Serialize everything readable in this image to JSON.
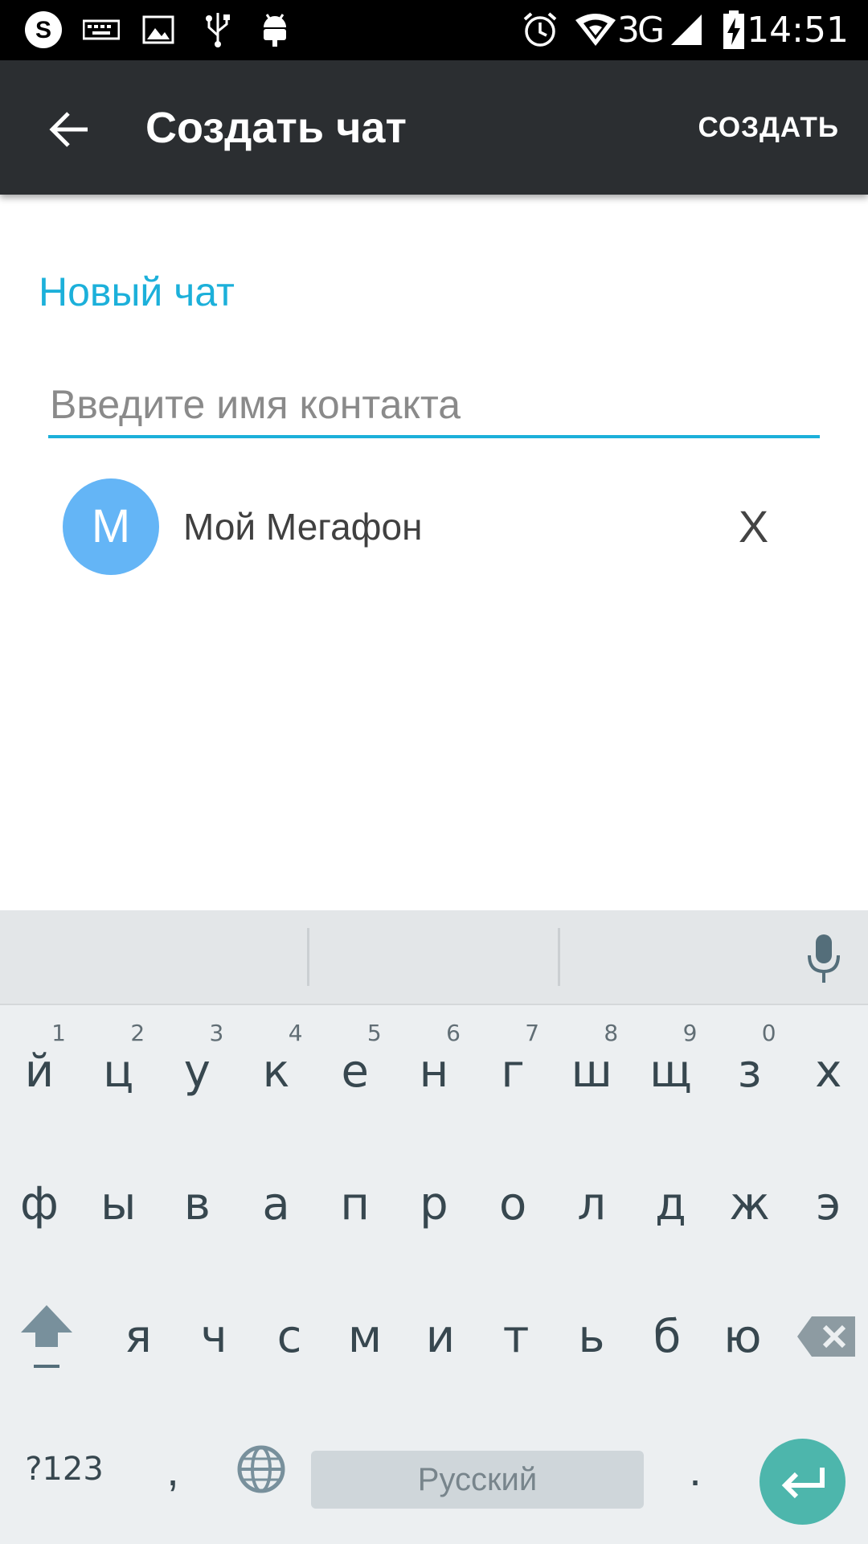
{
  "status_bar": {
    "time": "14:51",
    "network": "3G",
    "icons": [
      "skype-icon",
      "keyboard-icon",
      "image-icon",
      "usb-icon",
      "android-debug-icon",
      "alarm-icon",
      "wifi-icon",
      "signal-icon",
      "battery-charging-icon"
    ]
  },
  "toolbar": {
    "title": "Создать чат",
    "action_label": "СОЗДАТЬ",
    "back_icon": "arrow-back-icon"
  },
  "content": {
    "section_title": "Новый чат",
    "contact_input": {
      "value": "",
      "placeholder": "Введите имя контакта"
    },
    "selected_contacts": [
      {
        "initial": "M",
        "name": "Мой Мегафон",
        "remove_label": "X"
      }
    ]
  },
  "keyboard": {
    "row1": [
      {
        "letter": "й",
        "hint": "1"
      },
      {
        "letter": "ц",
        "hint": "2"
      },
      {
        "letter": "у",
        "hint": "3"
      },
      {
        "letter": "к",
        "hint": "4"
      },
      {
        "letter": "е",
        "hint": "5"
      },
      {
        "letter": "н",
        "hint": "6"
      },
      {
        "letter": "г",
        "hint": "7"
      },
      {
        "letter": "ш",
        "hint": "8"
      },
      {
        "letter": "щ",
        "hint": "9"
      },
      {
        "letter": "з",
        "hint": "0"
      },
      {
        "letter": "х",
        "hint": ""
      }
    ],
    "row2": [
      "ф",
      "ы",
      "в",
      "а",
      "п",
      "р",
      "о",
      "л",
      "д",
      "ж",
      "э"
    ],
    "row3": [
      "я",
      "ч",
      "с",
      "м",
      "и",
      "т",
      "ь",
      "б",
      "ю"
    ],
    "symbols_label": "?123",
    "comma_label": ",",
    "space_label": "Русский",
    "period_label": ".",
    "colors": {
      "accent": "#1cb0da",
      "enter": "#4db6ac",
      "avatar": "#64b5f6",
      "toolbar": "#2b2e31"
    }
  }
}
